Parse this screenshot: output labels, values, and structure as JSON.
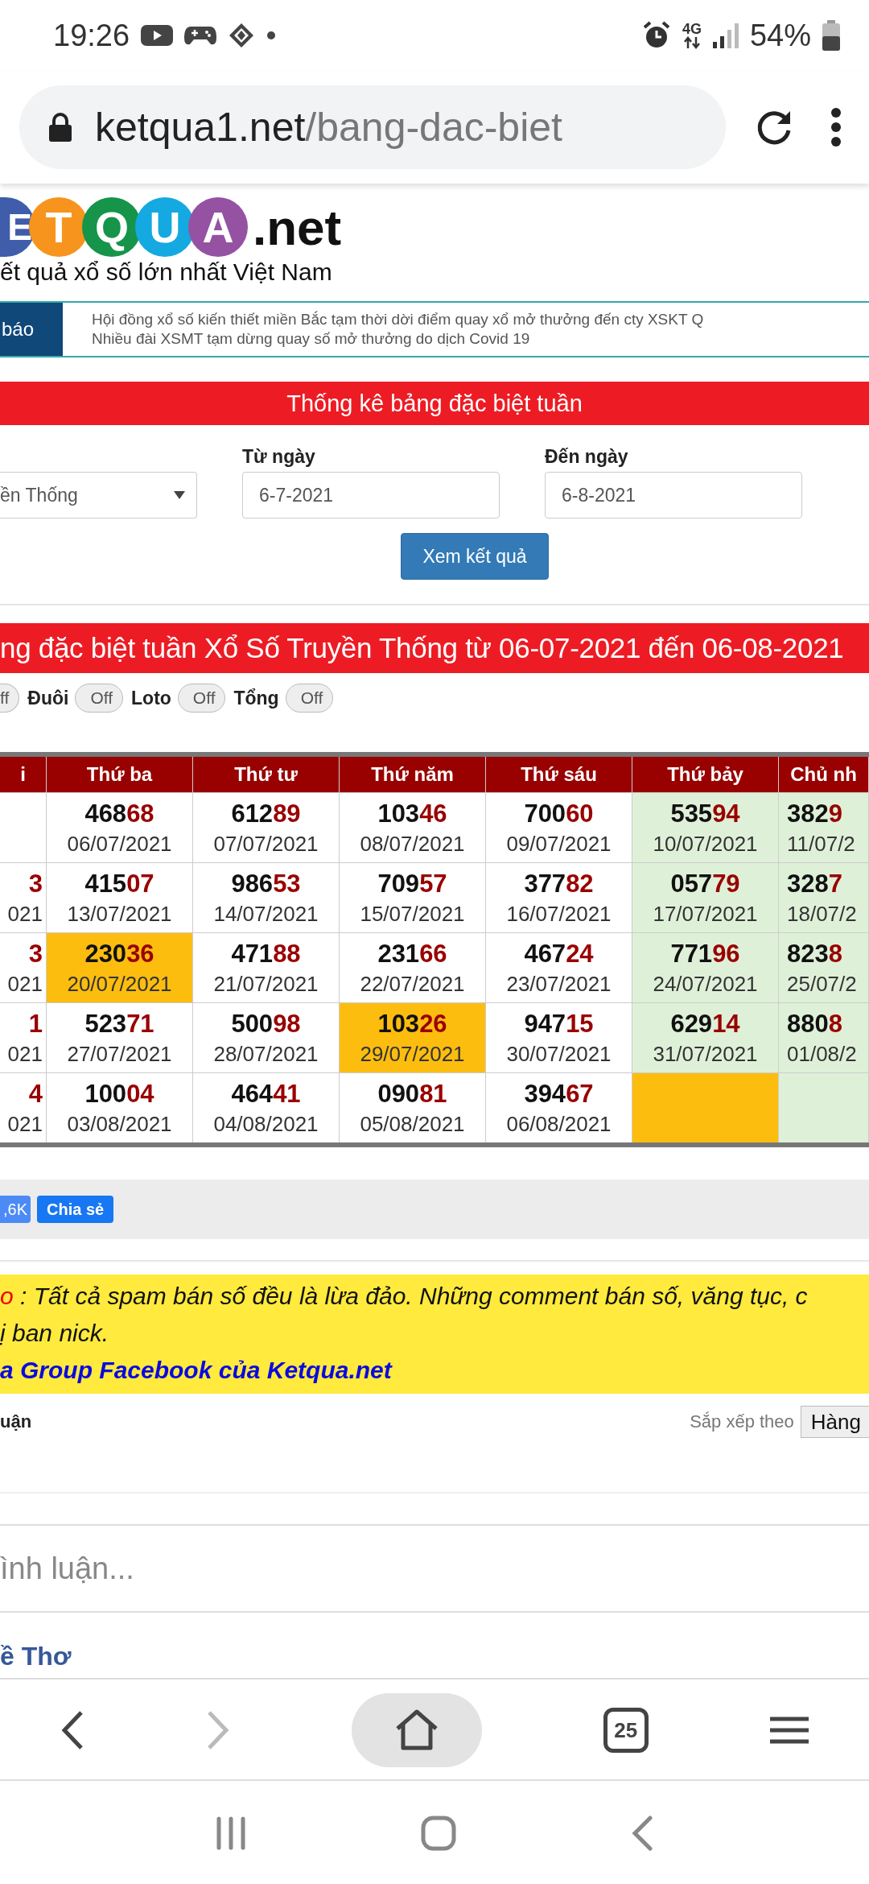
{
  "status_bar": {
    "time": "19:26",
    "network": "4G",
    "battery": "54%"
  },
  "browser": {
    "url_host": "ketqua1.net",
    "url_path": "/bang-dac-biet"
  },
  "logo": {
    "letters": [
      {
        "char": "E",
        "color": "#3f5dab"
      },
      {
        "char": "T",
        "color": "#f7941d"
      },
      {
        "char": "Q",
        "color": "#16944a"
      },
      {
        "char": "U",
        "color": "#14a9e1"
      },
      {
        "char": "A",
        "color": "#9552a3"
      }
    ],
    "suffix": ".net",
    "tagline": "ết quả xổ số lớn nhất Việt Nam"
  },
  "notices": {
    "tag": "báo",
    "items": [
      "Hội đồng xổ số kiến thiết miền Bắc tạm thời dời điểm quay xổ mở thưởng đến cty XSKT Q",
      "Nhiều đài XSMT tạm dừng quay số mở thưởng do dịch Covid 19"
    ]
  },
  "filter": {
    "title": "Thống kê bảng đặc biệt tuần",
    "lottery": "ền Thống",
    "from": {
      "label": "Từ ngày",
      "value": "6-7-2021"
    },
    "to": {
      "label": "Đến ngày",
      "value": "6-8-2021"
    },
    "submit": "Xem kết quả"
  },
  "result_title": "ng đặc biệt tuần Xổ Số Truyền Thống từ 06-07-2021 đến 06-08-2021",
  "toggles": [
    {
      "state_text": "ff",
      "on": false
    },
    {
      "label": "Đuôi",
      "state_text": "Off",
      "on": false
    },
    {
      "label": "Loto",
      "state_text": "Off",
      "on": false
    },
    {
      "label": "Tổng",
      "state_text": "Off",
      "on": false
    }
  ],
  "table": {
    "columns": [
      "i",
      "Thứ ba",
      "Thứ tư",
      "Thứ năm",
      "Thứ sáu",
      "Thứ bảy",
      "Chủ nh"
    ],
    "rows": [
      [
        {
          "kind": "plain"
        },
        {
          "kind": "plain",
          "prefix": "468",
          "suffix": "68",
          "date": "06/07/2021"
        },
        {
          "kind": "plain",
          "prefix": "612",
          "suffix": "89",
          "date": "07/07/2021"
        },
        {
          "kind": "plain",
          "prefix": "103",
          "suffix": "46",
          "date": "08/07/2021"
        },
        {
          "kind": "plain",
          "prefix": "700",
          "suffix": "60",
          "date": "09/07/2021"
        },
        {
          "kind": "weekend",
          "prefix": "535",
          "suffix": "94",
          "date": "10/07/2021"
        },
        {
          "kind": "weekend",
          "prefix": "382",
          "suffix": "9",
          "date": "11/07/2"
        }
      ],
      [
        {
          "kind": "plain",
          "suffix": "3",
          "date": "021"
        },
        {
          "kind": "plain",
          "prefix": "415",
          "suffix": "07",
          "date": "13/07/2021"
        },
        {
          "kind": "plain",
          "prefix": "986",
          "suffix": "53",
          "date": "14/07/2021"
        },
        {
          "kind": "plain",
          "prefix": "709",
          "suffix": "57",
          "date": "15/07/2021"
        },
        {
          "kind": "plain",
          "prefix": "377",
          "suffix": "82",
          "date": "16/07/2021"
        },
        {
          "kind": "weekend",
          "prefix": "057",
          "suffix": "79",
          "date": "17/07/2021"
        },
        {
          "kind": "weekend",
          "prefix": "328",
          "suffix": "7",
          "date": "18/07/2"
        }
      ],
      [
        {
          "kind": "plain",
          "suffix": "3",
          "date": "021"
        },
        {
          "kind": "marked",
          "prefix": "230",
          "suffix": "36",
          "date": "20/07/2021"
        },
        {
          "kind": "plain",
          "prefix": "471",
          "suffix": "88",
          "date": "21/07/2021"
        },
        {
          "kind": "plain",
          "prefix": "231",
          "suffix": "66",
          "date": "22/07/2021"
        },
        {
          "kind": "plain",
          "prefix": "467",
          "suffix": "24",
          "date": "23/07/2021"
        },
        {
          "kind": "weekend",
          "prefix": "771",
          "suffix": "96",
          "date": "24/07/2021"
        },
        {
          "kind": "weekend",
          "prefix": "823",
          "suffix": "8",
          "date": "25/07/2"
        }
      ],
      [
        {
          "kind": "plain",
          "suffix": "1",
          "date": "021"
        },
        {
          "kind": "plain",
          "prefix": "523",
          "suffix": "71",
          "date": "27/07/2021"
        },
        {
          "kind": "plain",
          "prefix": "500",
          "suffix": "98",
          "date": "28/07/2021"
        },
        {
          "kind": "marked",
          "prefix": "103",
          "suffix": "26",
          "date": "29/07/2021"
        },
        {
          "kind": "plain",
          "prefix": "947",
          "suffix": "15",
          "date": "30/07/2021"
        },
        {
          "kind": "weekend",
          "prefix": "629",
          "suffix": "14",
          "date": "31/07/2021"
        },
        {
          "kind": "weekend",
          "prefix": "880",
          "suffix": "8",
          "date": "01/08/2"
        }
      ],
      [
        {
          "kind": "plain",
          "suffix": "4",
          "date": "021"
        },
        {
          "kind": "plain",
          "prefix": "100",
          "suffix": "04",
          "date": "03/08/2021"
        },
        {
          "kind": "plain",
          "prefix": "464",
          "suffix": "41",
          "date": "04/08/2021"
        },
        {
          "kind": "plain",
          "prefix": "090",
          "suffix": "81",
          "date": "05/08/2021"
        },
        {
          "kind": "plain",
          "prefix": "394",
          "suffix": "67",
          "date": "06/08/2021"
        },
        {
          "kind": "marked"
        },
        {
          "kind": "weekend"
        }
      ]
    ]
  },
  "share": {
    "count": ",6K",
    "button": "Chia sẻ"
  },
  "warning": {
    "label": "o",
    "lines": [
      {
        "kind": "text",
        "text": ": Tất cả spam bán số đều là lừa đảo. Những comment bán số, văng tục, c"
      },
      {
        "kind": "text",
        "text": "ị ban nick."
      },
      {
        "kind": "link",
        "text": "a Group Facebook của Ketqua.net"
      }
    ]
  },
  "comments": {
    "title": "uận",
    "sort_label": "Sắp xếp theo",
    "sort_value": "Hàng",
    "placeholder": "ình luận...",
    "author": "ề Thơ"
  },
  "bottom_bar": {
    "tabs_count": "25",
    "forward_disabled": true
  }
}
